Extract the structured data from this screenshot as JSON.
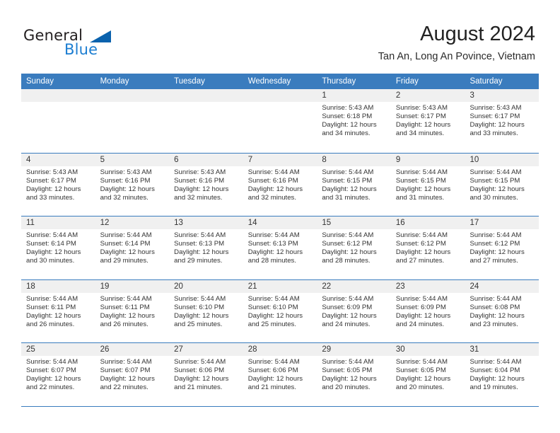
{
  "brand": {
    "name_part1": "General",
    "name_part2": "Blue",
    "triangle_color": "#0a62ad",
    "blue_color": "#1b7dd1"
  },
  "header": {
    "month_title": "August 2024",
    "location": "Tan An, Long An Povince, Vietnam",
    "header_bg": "#3a7cbe",
    "day_band_bg": "#f0f0f0"
  },
  "weekdays": [
    "Sunday",
    "Monday",
    "Tuesday",
    "Wednesday",
    "Thursday",
    "Friday",
    "Saturday"
  ],
  "labels": {
    "sunrise_prefix": "Sunrise:",
    "sunset_prefix": "Sunset:",
    "daylight_prefix": "Daylight:"
  },
  "weeks": [
    [
      {
        "day": "",
        "empty": true
      },
      {
        "day": "",
        "empty": true
      },
      {
        "day": "",
        "empty": true
      },
      {
        "day": "",
        "empty": true
      },
      {
        "day": "1",
        "sunrise": "Sunrise: 5:43 AM",
        "sunset": "Sunset: 6:18 PM",
        "daylight_line1": "Daylight: 12 hours",
        "daylight_line2": "and 34 minutes."
      },
      {
        "day": "2",
        "sunrise": "Sunrise: 5:43 AM",
        "sunset": "Sunset: 6:17 PM",
        "daylight_line1": "Daylight: 12 hours",
        "daylight_line2": "and 34 minutes."
      },
      {
        "day": "3",
        "sunrise": "Sunrise: 5:43 AM",
        "sunset": "Sunset: 6:17 PM",
        "daylight_line1": "Daylight: 12 hours",
        "daylight_line2": "and 33 minutes."
      }
    ],
    [
      {
        "day": "4",
        "sunrise": "Sunrise: 5:43 AM",
        "sunset": "Sunset: 6:17 PM",
        "daylight_line1": "Daylight: 12 hours",
        "daylight_line2": "and 33 minutes."
      },
      {
        "day": "5",
        "sunrise": "Sunrise: 5:43 AM",
        "sunset": "Sunset: 6:16 PM",
        "daylight_line1": "Daylight: 12 hours",
        "daylight_line2": "and 32 minutes."
      },
      {
        "day": "6",
        "sunrise": "Sunrise: 5:43 AM",
        "sunset": "Sunset: 6:16 PM",
        "daylight_line1": "Daylight: 12 hours",
        "daylight_line2": "and 32 minutes."
      },
      {
        "day": "7",
        "sunrise": "Sunrise: 5:44 AM",
        "sunset": "Sunset: 6:16 PM",
        "daylight_line1": "Daylight: 12 hours",
        "daylight_line2": "and 32 minutes."
      },
      {
        "day": "8",
        "sunrise": "Sunrise: 5:44 AM",
        "sunset": "Sunset: 6:15 PM",
        "daylight_line1": "Daylight: 12 hours",
        "daylight_line2": "and 31 minutes."
      },
      {
        "day": "9",
        "sunrise": "Sunrise: 5:44 AM",
        "sunset": "Sunset: 6:15 PM",
        "daylight_line1": "Daylight: 12 hours",
        "daylight_line2": "and 31 minutes."
      },
      {
        "day": "10",
        "sunrise": "Sunrise: 5:44 AM",
        "sunset": "Sunset: 6:15 PM",
        "daylight_line1": "Daylight: 12 hours",
        "daylight_line2": "and 30 minutes."
      }
    ],
    [
      {
        "day": "11",
        "sunrise": "Sunrise: 5:44 AM",
        "sunset": "Sunset: 6:14 PM",
        "daylight_line1": "Daylight: 12 hours",
        "daylight_line2": "and 30 minutes."
      },
      {
        "day": "12",
        "sunrise": "Sunrise: 5:44 AM",
        "sunset": "Sunset: 6:14 PM",
        "daylight_line1": "Daylight: 12 hours",
        "daylight_line2": "and 29 minutes."
      },
      {
        "day": "13",
        "sunrise": "Sunrise: 5:44 AM",
        "sunset": "Sunset: 6:13 PM",
        "daylight_line1": "Daylight: 12 hours",
        "daylight_line2": "and 29 minutes."
      },
      {
        "day": "14",
        "sunrise": "Sunrise: 5:44 AM",
        "sunset": "Sunset: 6:13 PM",
        "daylight_line1": "Daylight: 12 hours",
        "daylight_line2": "and 28 minutes."
      },
      {
        "day": "15",
        "sunrise": "Sunrise: 5:44 AM",
        "sunset": "Sunset: 6:12 PM",
        "daylight_line1": "Daylight: 12 hours",
        "daylight_line2": "and 28 minutes."
      },
      {
        "day": "16",
        "sunrise": "Sunrise: 5:44 AM",
        "sunset": "Sunset: 6:12 PM",
        "daylight_line1": "Daylight: 12 hours",
        "daylight_line2": "and 27 minutes."
      },
      {
        "day": "17",
        "sunrise": "Sunrise: 5:44 AM",
        "sunset": "Sunset: 6:12 PM",
        "daylight_line1": "Daylight: 12 hours",
        "daylight_line2": "and 27 minutes."
      }
    ],
    [
      {
        "day": "18",
        "sunrise": "Sunrise: 5:44 AM",
        "sunset": "Sunset: 6:11 PM",
        "daylight_line1": "Daylight: 12 hours",
        "daylight_line2": "and 26 minutes."
      },
      {
        "day": "19",
        "sunrise": "Sunrise: 5:44 AM",
        "sunset": "Sunset: 6:11 PM",
        "daylight_line1": "Daylight: 12 hours",
        "daylight_line2": "and 26 minutes."
      },
      {
        "day": "20",
        "sunrise": "Sunrise: 5:44 AM",
        "sunset": "Sunset: 6:10 PM",
        "daylight_line1": "Daylight: 12 hours",
        "daylight_line2": "and 25 minutes."
      },
      {
        "day": "21",
        "sunrise": "Sunrise: 5:44 AM",
        "sunset": "Sunset: 6:10 PM",
        "daylight_line1": "Daylight: 12 hours",
        "daylight_line2": "and 25 minutes."
      },
      {
        "day": "22",
        "sunrise": "Sunrise: 5:44 AM",
        "sunset": "Sunset: 6:09 PM",
        "daylight_line1": "Daylight: 12 hours",
        "daylight_line2": "and 24 minutes."
      },
      {
        "day": "23",
        "sunrise": "Sunrise: 5:44 AM",
        "sunset": "Sunset: 6:09 PM",
        "daylight_line1": "Daylight: 12 hours",
        "daylight_line2": "and 24 minutes."
      },
      {
        "day": "24",
        "sunrise": "Sunrise: 5:44 AM",
        "sunset": "Sunset: 6:08 PM",
        "daylight_line1": "Daylight: 12 hours",
        "daylight_line2": "and 23 minutes."
      }
    ],
    [
      {
        "day": "25",
        "sunrise": "Sunrise: 5:44 AM",
        "sunset": "Sunset: 6:07 PM",
        "daylight_line1": "Daylight: 12 hours",
        "daylight_line2": "and 22 minutes."
      },
      {
        "day": "26",
        "sunrise": "Sunrise: 5:44 AM",
        "sunset": "Sunset: 6:07 PM",
        "daylight_line1": "Daylight: 12 hours",
        "daylight_line2": "and 22 minutes."
      },
      {
        "day": "27",
        "sunrise": "Sunrise: 5:44 AM",
        "sunset": "Sunset: 6:06 PM",
        "daylight_line1": "Daylight: 12 hours",
        "daylight_line2": "and 21 minutes."
      },
      {
        "day": "28",
        "sunrise": "Sunrise: 5:44 AM",
        "sunset": "Sunset: 6:06 PM",
        "daylight_line1": "Daylight: 12 hours",
        "daylight_line2": "and 21 minutes."
      },
      {
        "day": "29",
        "sunrise": "Sunrise: 5:44 AM",
        "sunset": "Sunset: 6:05 PM",
        "daylight_line1": "Daylight: 12 hours",
        "daylight_line2": "and 20 minutes."
      },
      {
        "day": "30",
        "sunrise": "Sunrise: 5:44 AM",
        "sunset": "Sunset: 6:05 PM",
        "daylight_line1": "Daylight: 12 hours",
        "daylight_line2": "and 20 minutes."
      },
      {
        "day": "31",
        "sunrise": "Sunrise: 5:44 AM",
        "sunset": "Sunset: 6:04 PM",
        "daylight_line1": "Daylight: 12 hours",
        "daylight_line2": "and 19 minutes."
      }
    ]
  ]
}
